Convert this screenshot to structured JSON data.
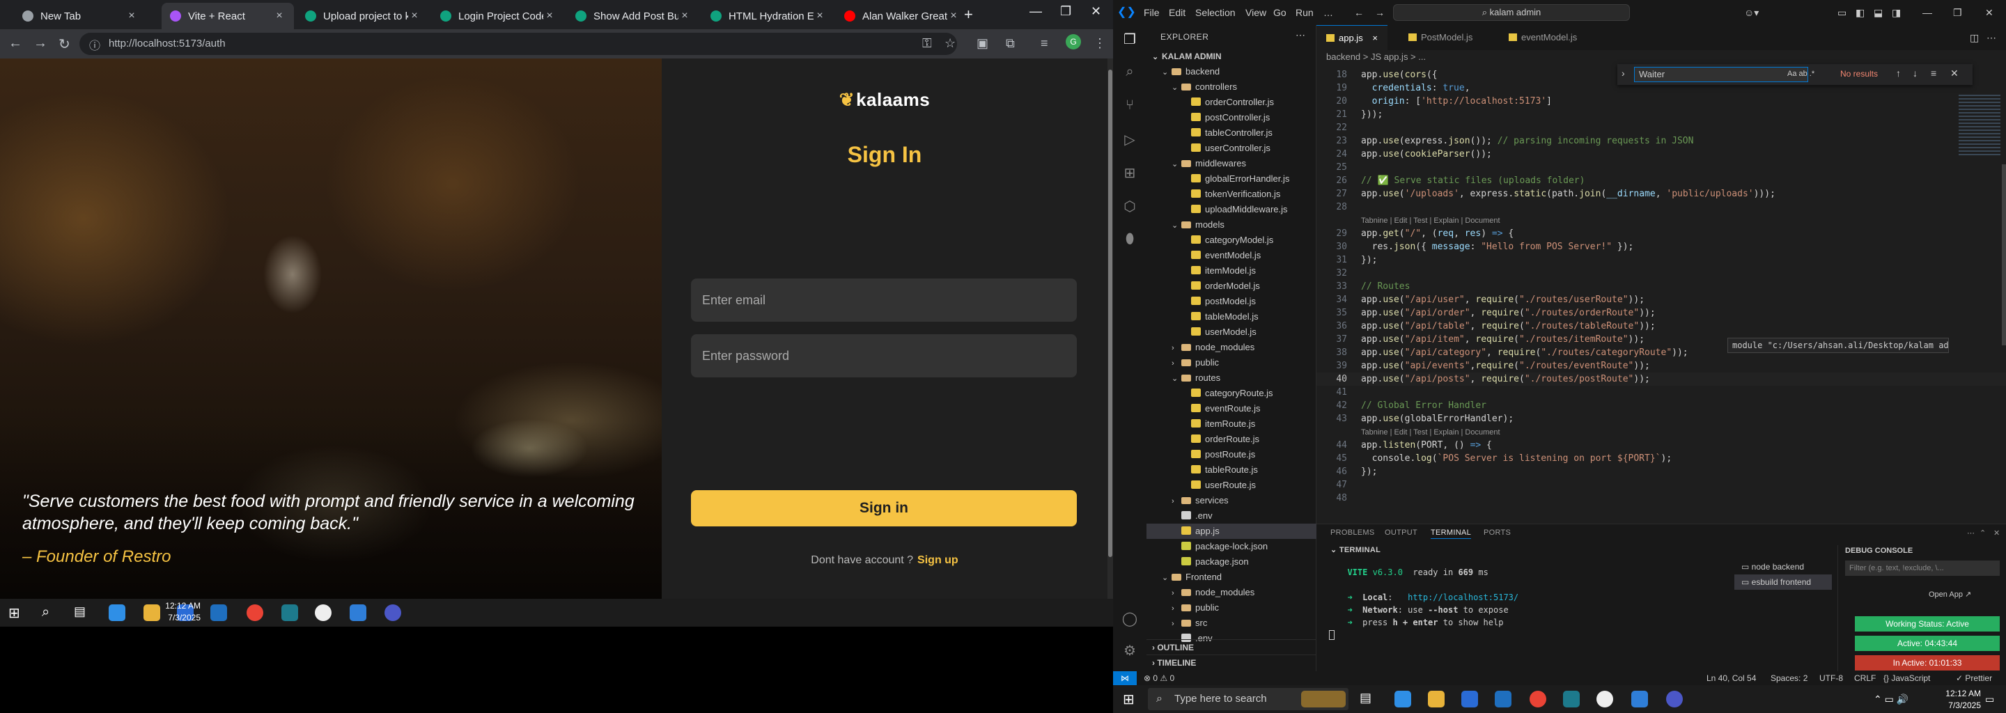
{
  "browser": {
    "tabs": [
      {
        "title": "New Tab",
        "favicon": "#9aa0a6"
      },
      {
        "title": "Vite + React",
        "favicon": "#a855f7"
      },
      {
        "title": "Upload project to kala",
        "favicon": "#10a37f"
      },
      {
        "title": "Login Project Code He",
        "favicon": "#10a37f"
      },
      {
        "title": "Show Add Post Button",
        "favicon": "#10a37f"
      },
      {
        "title": "HTML Hydration Error",
        "favicon": "#10a37f"
      },
      {
        "title": "Alan Walker Greatest",
        "favicon": "#ff0000"
      }
    ],
    "close_glyph": "×",
    "new_tab_glyph": "+",
    "url": "http://localhost:5173/auth"
  },
  "auth_page": {
    "logo_text": "kalaams",
    "title": "Sign In",
    "email_placeholder": "Enter email",
    "password_placeholder": "Enter password",
    "signin_button": "Sign in",
    "no_account_text": "Dont have account ?",
    "signup_link": "Sign up",
    "quote": "\"Serve customers the best food with prompt and friendly service in a welcoming atmosphere, and they'll keep coming back.\"",
    "quote_author": "– Founder of Restro",
    "accent_color": "#f6c343"
  },
  "taskbar_left": {
    "time": "12:12 AM",
    "date": "7/3/2025"
  },
  "vscode": {
    "menu": [
      "File",
      "Edit",
      "Selection",
      "View",
      "Go",
      "Run",
      "…"
    ],
    "command_center": "kalam admin",
    "explorer_title": "EXPLORER",
    "workspace": "KALAM ADMIN",
    "tree": [
      {
        "name": "backend",
        "kind": "folder",
        "depth": 1,
        "open": true
      },
      {
        "name": "controllers",
        "kind": "folder",
        "depth": 2,
        "open": true
      },
      {
        "name": "orderController.js",
        "kind": "js",
        "depth": 3
      },
      {
        "name": "postController.js",
        "kind": "js",
        "depth": 3
      },
      {
        "name": "tableController.js",
        "kind": "js",
        "depth": 3
      },
      {
        "name": "userController.js",
        "kind": "js",
        "depth": 3
      },
      {
        "name": "middlewares",
        "kind": "folder",
        "depth": 2,
        "open": true
      },
      {
        "name": "globalErrorHandler.js",
        "kind": "js",
        "depth": 3
      },
      {
        "name": "tokenVerification.js",
        "kind": "js",
        "depth": 3
      },
      {
        "name": "uploadMiddleware.js",
        "kind": "js",
        "depth": 3
      },
      {
        "name": "models",
        "kind": "folder",
        "depth": 2,
        "open": true
      },
      {
        "name": "categoryModel.js",
        "kind": "js",
        "depth": 3
      },
      {
        "name": "eventModel.js",
        "kind": "js",
        "depth": 3
      },
      {
        "name": "itemModel.js",
        "kind": "js",
        "depth": 3
      },
      {
        "name": "orderModel.js",
        "kind": "js",
        "depth": 3
      },
      {
        "name": "postModel.js",
        "kind": "js",
        "depth": 3
      },
      {
        "name": "tableModel.js",
        "kind": "js",
        "depth": 3
      },
      {
        "name": "userModel.js",
        "kind": "js",
        "depth": 3
      },
      {
        "name": "node_modules",
        "kind": "folder",
        "depth": 2,
        "open": false
      },
      {
        "name": "public",
        "kind": "folder",
        "depth": 2,
        "open": false
      },
      {
        "name": "routes",
        "kind": "folder",
        "depth": 2,
        "open": true
      },
      {
        "name": "categoryRoute.js",
        "kind": "js",
        "depth": 3
      },
      {
        "name": "eventRoute.js",
        "kind": "js",
        "depth": 3
      },
      {
        "name": "itemRoute.js",
        "kind": "js",
        "depth": 3
      },
      {
        "name": "orderRoute.js",
        "kind": "js",
        "depth": 3
      },
      {
        "name": "postRoute.js",
        "kind": "js",
        "depth": 3
      },
      {
        "name": "tableRoute.js",
        "kind": "js",
        "depth": 3
      },
      {
        "name": "userRoute.js",
        "kind": "js",
        "depth": 3
      },
      {
        "name": "services",
        "kind": "folder",
        "depth": 2,
        "open": false
      },
      {
        "name": ".env",
        "kind": "env",
        "depth": 2
      },
      {
        "name": "app.js",
        "kind": "js",
        "depth": 2,
        "selected": true
      },
      {
        "name": "package-lock.json",
        "kind": "json",
        "depth": 2
      },
      {
        "name": "package.json",
        "kind": "json",
        "depth": 2
      },
      {
        "name": "Frontend",
        "kind": "folder",
        "depth": 1,
        "open": true
      },
      {
        "name": "node_modules",
        "kind": "folder",
        "depth": 2,
        "open": false
      },
      {
        "name": "public",
        "kind": "folder",
        "depth": 2,
        "open": false
      },
      {
        "name": "src",
        "kind": "folder",
        "depth": 2,
        "open": false
      },
      {
        "name": ".env",
        "kind": "env",
        "depth": 2
      }
    ],
    "outline_label": "OUTLINE",
    "timeline_label": "TIMELINE",
    "editor_tabs": [
      "app.js",
      "PostModel.js",
      "eventModel.js"
    ],
    "breadcrumb": "backend > JS app.js > ...",
    "find": {
      "query": "Waiter",
      "result": "No results"
    },
    "hover_text": "module \"c:/Users/ahsan.ali/Desktop/kalam admin/backend/routes/itemRoute\"",
    "code_lines": [
      {
        "n": "18",
        "html": "<span class='pl'>app.</span><span class='fn'>use</span><span class='pl'>(</span><span class='fn'>cors</span><span class='pl'>({</span>"
      },
      {
        "n": "19",
        "html": "<span class='pl'>  </span><span class='var'>credentials</span><span class='pl'>: </span><span class='lit'>true</span><span class='pl'>,</span>"
      },
      {
        "n": "20",
        "html": "<span class='pl'>  </span><span class='var'>origin</span><span class='pl'>: [</span><span class='str'>'http://localhost:5173'</span><span class='pl'>]</span>"
      },
      {
        "n": "21",
        "html": "<span class='pl'>}));</span>"
      },
      {
        "n": "22",
        "html": ""
      },
      {
        "n": "23",
        "html": "<span class='pl'>app.</span><span class='fn'>use</span><span class='pl'>(express.</span><span class='fn'>json</span><span class='pl'>()); </span><span class='com'>// parsing incoming requests in JSON</span>"
      },
      {
        "n": "24",
        "html": "<span class='pl'>app.</span><span class='fn'>use</span><span class='pl'>(</span><span class='fn'>cookieParser</span><span class='pl'>());</span>"
      },
      {
        "n": "25",
        "html": ""
      },
      {
        "n": "26",
        "html": "<span class='com'>// ✅ Serve static files (uploads folder)</span>"
      },
      {
        "n": "27",
        "html": "<span class='pl'>app.</span><span class='fn'>use</span><span class='pl'>(</span><span class='str'>'/uploads'</span><span class='pl'>, express.</span><span class='fn'>static</span><span class='pl'>(path.</span><span class='fn'>join</span><span class='pl'>(</span><span class='var'>__dirname</span><span class='pl'>, </span><span class='str'>'public/uploads'</span><span class='pl'>)));</span>"
      },
      {
        "n": "28",
        "html": ""
      },
      {
        "n": "",
        "html": "<span class='lens'>Tabnine | Edit | Test | Explain | Document</span>"
      },
      {
        "n": "29",
        "html": "<span class='pl'>app.</span><span class='fn'>get</span><span class='pl'>(</span><span class='str'>\"/\"</span><span class='pl'>, (</span><span class='var'>req</span><span class='pl'>, </span><span class='var'>res</span><span class='pl'>) </span><span class='lit'>=&gt;</span><span class='pl'> {</span>"
      },
      {
        "n": "30",
        "html": "<span class='pl'>  res.</span><span class='fn'>json</span><span class='pl'>({ </span><span class='var'>message</span><span class='pl'>: </span><span class='str'>\"Hello from POS Server!\"</span><span class='pl'> });</span>"
      },
      {
        "n": "31",
        "html": "<span class='pl'>});</span>"
      },
      {
        "n": "32",
        "html": ""
      },
      {
        "n": "33",
        "html": "<span class='com'>// Routes</span>"
      },
      {
        "n": "34",
        "html": "<span class='pl'>app.</span><span class='fn'>use</span><span class='pl'>(</span><span class='str'>\"/api/user\"</span><span class='pl'>, </span><span class='fn'>require</span><span class='pl'>(</span><span class='str'>\"./routes/userRoute\"</span><span class='pl'>));</span>"
      },
      {
        "n": "35",
        "html": "<span class='pl'>app.</span><span class='fn'>use</span><span class='pl'>(</span><span class='str'>\"/api/order\"</span><span class='pl'>, </span><span class='fn'>require</span><span class='pl'>(</span><span class='str'>\"./routes/orderRoute\"</span><span class='pl'>));</span>"
      },
      {
        "n": "36",
        "html": "<span class='pl'>app.</span><span class='fn'>use</span><span class='pl'>(</span><span class='str'>\"/api/table\"</span><span class='pl'>, </span><span class='fn'>require</span><span class='pl'>(</span><span class='str'>\"./routes/tableRoute\"</span><span class='pl'>));</span>"
      },
      {
        "n": "37",
        "html": "<span class='pl'>app.</span><span class='fn'>use</span><span class='pl'>(</span><span class='str'>\"/api/item\"</span><span class='pl'>, </span><span class='fn'>require</span><span class='pl'>(</span><span class='str'>\"./routes/itemRoute\"</span><span class='pl'>));</span>"
      },
      {
        "n": "38",
        "html": "<span class='pl'>app.</span><span class='fn'>use</span><span class='pl'>(</span><span class='str'>\"/api/category\"</span><span class='pl'>, </span><span class='fn'>require</span><span class='pl'>(</span><span class='str'>\"./routes/categoryRoute\"</span><span class='pl'>));</span>"
      },
      {
        "n": "39",
        "html": "<span class='pl'>app.</span><span class='fn'>use</span><span class='pl'>(</span><span class='str'>\"api/events\"</span><span class='pl'>,</span><span class='fn'>require</span><span class='pl'>(</span><span class='str'>\"./routes/eventRoute\"</span><span class='pl'>));</span>"
      },
      {
        "n": "40",
        "html": "<span class='pl'>app.</span><span class='fn'>use</span><span class='pl'>(</span><span class='str'>\"/api/posts\"</span><span class='pl'>, </span><span class='fn'>require</span><span class='pl'>(</span><span class='str'>\"./routes/postRoute\"</span><span class='pl'>));</span>",
        "current": true
      },
      {
        "n": "41",
        "html": ""
      },
      {
        "n": "42",
        "html": "<span class='com'>// Global Error Handler</span>"
      },
      {
        "n": "43",
        "html": "<span class='pl'>app.</span><span class='fn'>use</span><span class='pl'>(globalErrorHandler);</span>"
      },
      {
        "n": "",
        "html": "<span class='lens'>Tabnine | Edit | Test | Explain | Document</span>"
      },
      {
        "n": "44",
        "html": "<span class='pl'>app.</span><span class='fn'>listen</span><span class='pl'>(PORT, () </span><span class='lit'>=&gt;</span><span class='pl'> {</span>"
      },
      {
        "n": "45",
        "html": "<span class='pl'>  console.</span><span class='fn'>log</span><span class='pl'>(</span><span class='str'>`POS Server is listening on port ${PORT}`</span><span class='pl'>);</span>"
      },
      {
        "n": "46",
        "html": "<span class='pl'>});</span>"
      },
      {
        "n": "47",
        "html": ""
      },
      {
        "n": "48",
        "html": ""
      }
    ],
    "panel_tabs": [
      "PROBLEMS",
      "OUTPUT",
      "TERMINAL",
      "PORTS"
    ],
    "terminal_header": "TERMINAL",
    "terminal_lines": [
      {
        "html": "  <span class='g b'>VITE</span> <span class='g'>v6.3.0</span>  ready in <span class='b'>669</span> ms"
      },
      {
        "html": ""
      },
      {
        "html": "  <span class='g'>➜</span>  <span class='b'>Local</span>:   <span class='c'>http://localhost:5173/</span>"
      },
      {
        "html": "  <span class='g'>➜</span>  <span class='b'>Network</span>: use <span class='b'>--host</span> to expose"
      },
      {
        "html": "  <span class='g'>➜</span>  press <span class='b'>h + enter</span> to show help"
      }
    ],
    "terminals": [
      "node backend",
      "esbuild frontend"
    ],
    "debug_console": {
      "title": "DEBUG CONSOLE",
      "filter": "Filter (e.g. text, !exclude, \\..."
    },
    "open_app": "Open App ↗",
    "extension_badges": [
      {
        "label": "Working Status: Active",
        "color": "#27ae60"
      },
      {
        "label": "Active: 04:43:44",
        "color": "#27ae60"
      },
      {
        "label": "In Active: 01:01:33",
        "color": "#c0392b"
      }
    ],
    "status": {
      "errors": "⊗ 0  ⚠ 0",
      "position": "Ln 40, Col 54",
      "spaces": "Spaces: 2",
      "encoding": "UTF-8",
      "eol": "CRLF",
      "language": "{} JavaScript",
      "prettier": "✓ Prettier"
    }
  },
  "taskbar_right": {
    "search_placeholder": "Type here to search",
    "time": "12:12 AM",
    "date": "7/3/2025"
  }
}
